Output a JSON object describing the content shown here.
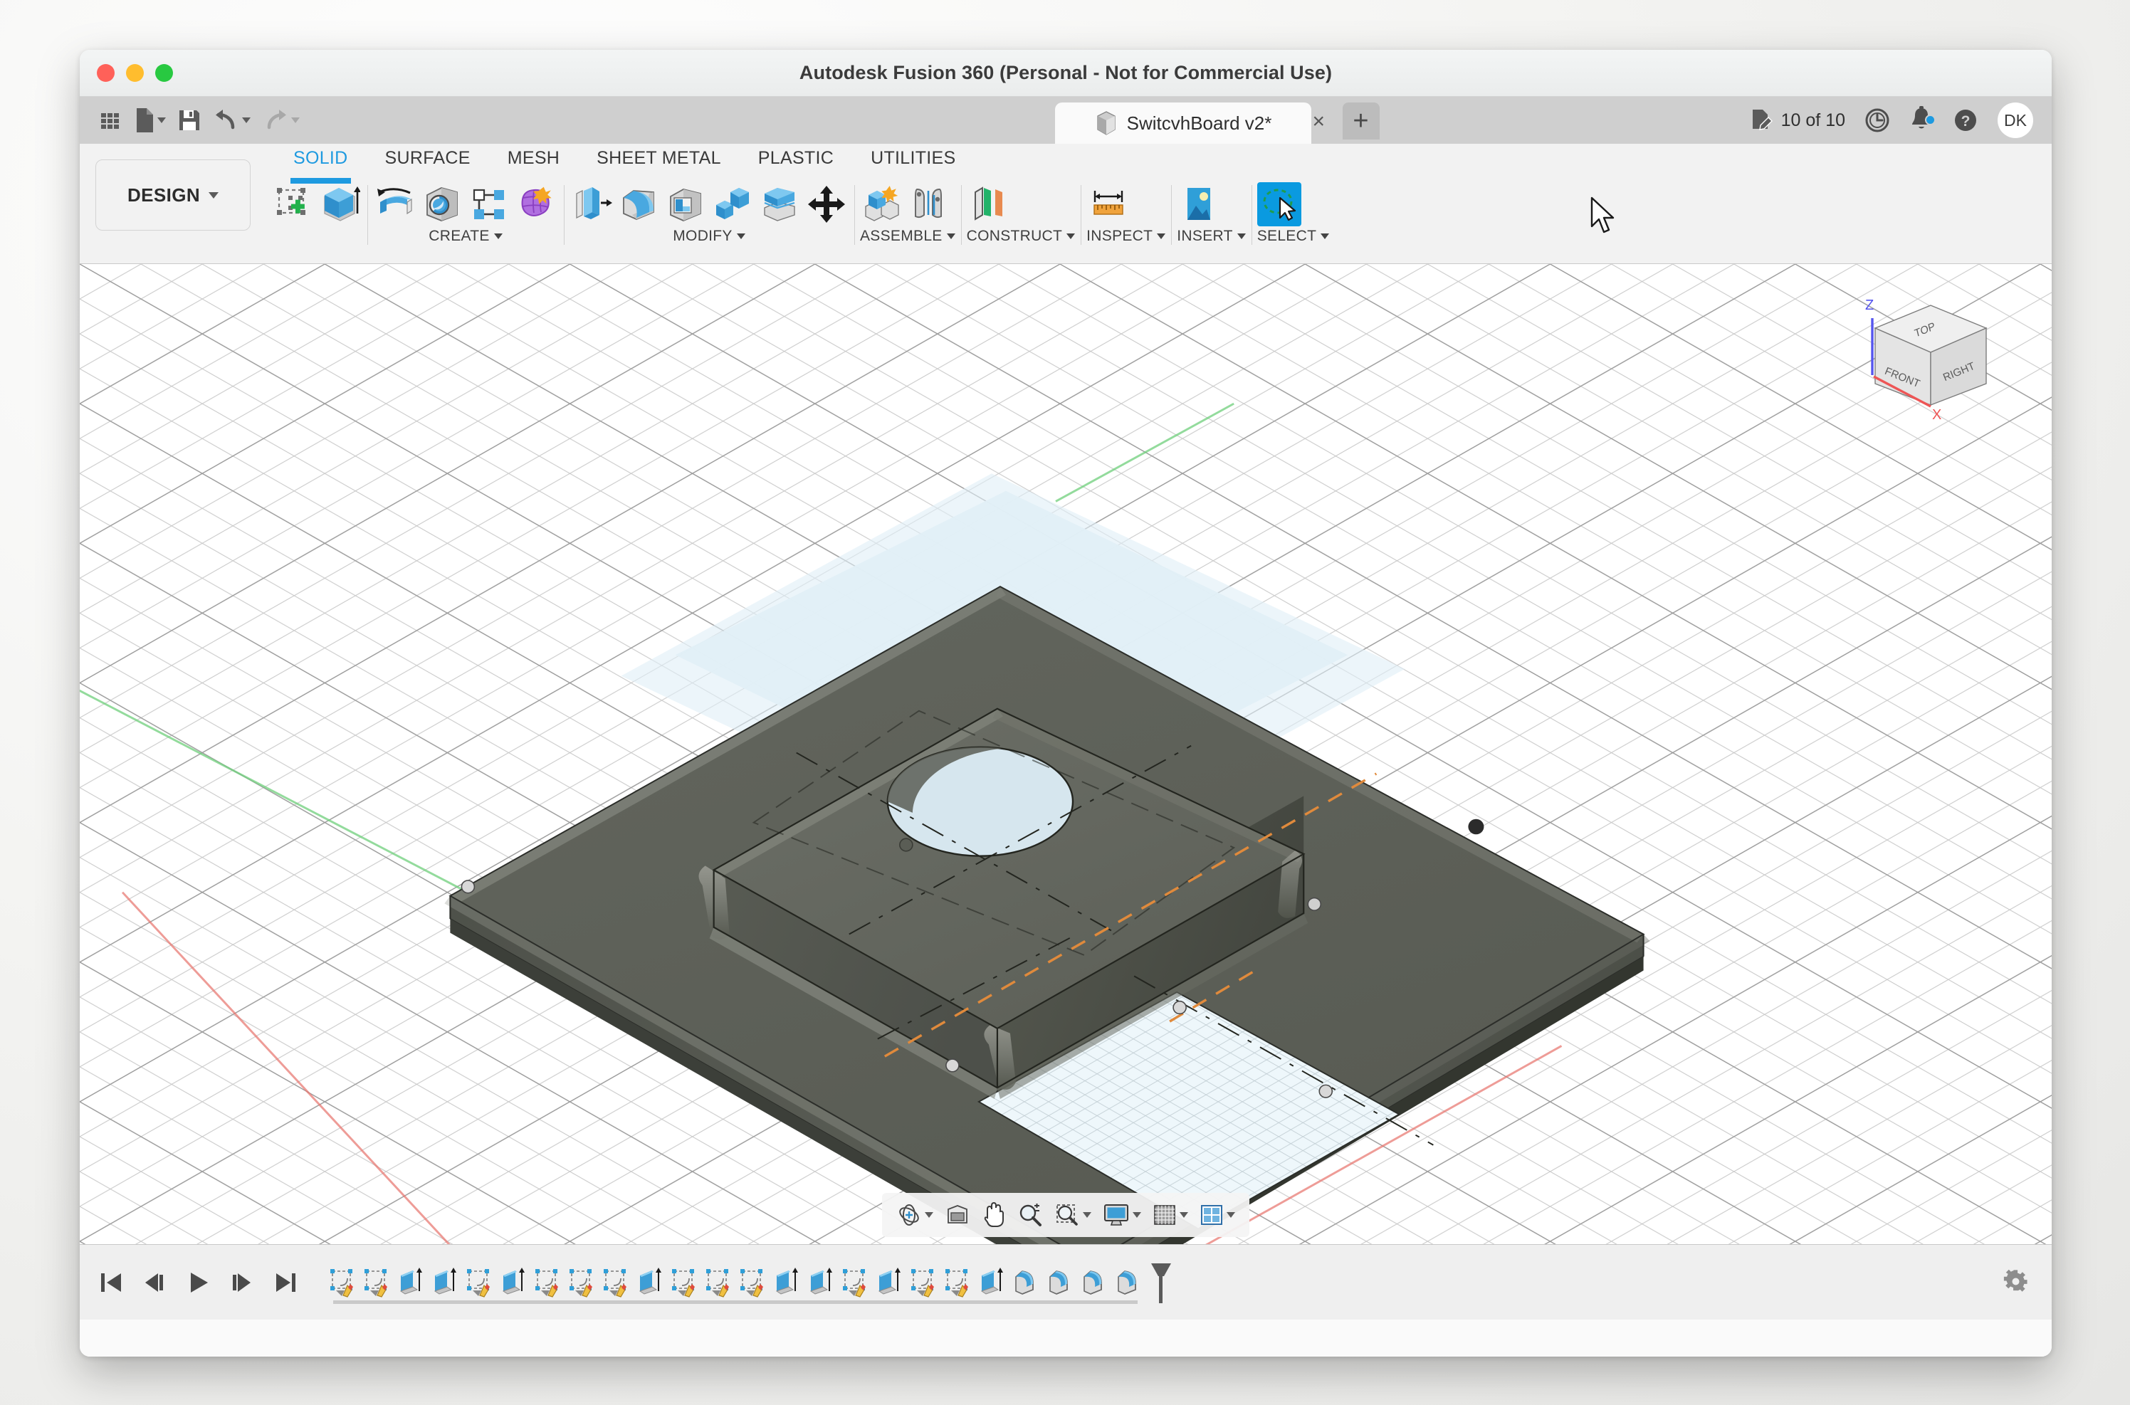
{
  "window": {
    "title": "Autodesk Fusion 360 (Personal - Not for Commercial Use)",
    "traffic": {
      "close": "close-button",
      "minimize": "minimize-button",
      "zoom": "zoom-button"
    }
  },
  "quick_access": {
    "items": [
      {
        "name": "show-data-panel",
        "icon": "grid-icon"
      },
      {
        "name": "file-menu",
        "icon": "file-icon",
        "has_caret": true
      },
      {
        "name": "save-button",
        "icon": "save-icon"
      },
      {
        "name": "undo-button",
        "icon": "undo-icon",
        "has_caret": true
      },
      {
        "name": "redo-button",
        "icon": "redo-icon",
        "has_caret": true
      }
    ]
  },
  "document_tab": {
    "label": "SwitcvhBoard v2*",
    "icon": "cube-icon",
    "close_label": "×",
    "new_tab_label": "+"
  },
  "header_right": {
    "jobs_status": "10 of 10",
    "jobs_icon": "job-status-icon",
    "history_icon": "clock-icon",
    "notifications_icon": "bell-icon",
    "notification_badge": true,
    "help_icon": "help-icon",
    "avatar_initials": "DK"
  },
  "ribbon": {
    "workspace_button": "DESIGN",
    "tabs": [
      {
        "label": "SOLID",
        "active": true
      },
      {
        "label": "SURFACE",
        "active": false
      },
      {
        "label": "MESH",
        "active": false
      },
      {
        "label": "SHEET METAL",
        "active": false
      },
      {
        "label": "PLASTIC",
        "active": false
      },
      {
        "label": "UTILITIES",
        "active": false
      }
    ],
    "panels": [
      {
        "label": "",
        "tools": [
          {
            "name": "create-sketch-button",
            "icon": "sketch-plus-icon"
          },
          {
            "name": "extrude-button",
            "icon": "extrude-icon"
          }
        ]
      },
      {
        "label": "CREATE",
        "tools": [
          {
            "name": "revolve-button",
            "icon": "revolve-icon"
          },
          {
            "name": "hole-button",
            "icon": "hole-icon"
          },
          {
            "name": "pattern-button",
            "icon": "pattern-icon"
          },
          {
            "name": "create-form-button",
            "icon": "form-icon"
          }
        ]
      },
      {
        "label": "MODIFY",
        "tools": [
          {
            "name": "press-pull-button",
            "icon": "press-pull-icon"
          },
          {
            "name": "fillet-button",
            "icon": "fillet-icon"
          },
          {
            "name": "shell-button",
            "icon": "shell-icon"
          },
          {
            "name": "combine-button",
            "icon": "combine-icon"
          },
          {
            "name": "split-face-button",
            "icon": "split-face-icon"
          },
          {
            "name": "move-copy-button",
            "icon": "move-copy-icon"
          }
        ]
      },
      {
        "label": "ASSEMBLE",
        "tools": [
          {
            "name": "new-component-button",
            "icon": "new-component-icon"
          },
          {
            "name": "joint-button",
            "icon": "joint-icon"
          }
        ]
      },
      {
        "label": "CONSTRUCT",
        "tools": [
          {
            "name": "offset-plane-button",
            "icon": "offset-plane-icon"
          }
        ]
      },
      {
        "label": "INSPECT",
        "tools": [
          {
            "name": "measure-button",
            "icon": "measure-icon"
          }
        ]
      },
      {
        "label": "INSERT",
        "tools": [
          {
            "name": "insert-image-button",
            "icon": "image-icon"
          }
        ]
      },
      {
        "label": "SELECT",
        "selected": true,
        "tools": [
          {
            "name": "select-tool-button",
            "icon": "select-lasso-icon"
          }
        ]
      }
    ]
  },
  "viewport": {
    "viewcube": {
      "faces": {
        "top": "TOP",
        "front": "FRONT",
        "right": "RIGHT"
      },
      "axes": {
        "z": "Z",
        "x": "X"
      },
      "axis_colors": {
        "z": "#5555ee",
        "x": "#ee5555"
      }
    },
    "origin_axes": {
      "x_color": "#e8736c",
      "y_color": "#6fcf7c"
    },
    "model": {
      "name": "switch-board-plate",
      "body_color": "#5f6159",
      "body_highlight": "#6f7168",
      "sketch_plane_color": "#e8f3f8",
      "construction_line_color": "#2b2b2b",
      "sketch_line_color": "#e08a3c"
    },
    "navbar": [
      {
        "name": "orbit-button",
        "icon": "orbit-icon",
        "has_caret": true
      },
      {
        "name": "look-at-button",
        "icon": "look-at-icon",
        "has_caret": false
      },
      {
        "name": "pan-button",
        "icon": "pan-hand-icon",
        "has_caret": false
      },
      {
        "name": "zoom-button",
        "icon": "zoom-magnifier-icon",
        "has_caret": false
      },
      {
        "name": "zoom-window-button",
        "icon": "zoom-window-icon",
        "has_caret": true
      },
      {
        "name": "display-settings-button",
        "icon": "monitor-icon",
        "has_caret": true
      },
      {
        "name": "grid-snap-button",
        "icon": "grid-icon",
        "has_caret": true
      },
      {
        "name": "viewports-button",
        "icon": "viewports-icon",
        "has_caret": true
      }
    ]
  },
  "timeline": {
    "playback": [
      {
        "name": "go-to-beginning-button",
        "icon": "skip-start-icon"
      },
      {
        "name": "step-back-button",
        "icon": "step-back-icon"
      },
      {
        "name": "play-button",
        "icon": "play-icon"
      },
      {
        "name": "step-forward-button",
        "icon": "step-forward-icon"
      },
      {
        "name": "go-to-end-button",
        "icon": "skip-end-icon"
      }
    ],
    "features": [
      {
        "type": "sketch",
        "icon": "sketch-feature-icon"
      },
      {
        "type": "sketch",
        "icon": "sketch-feature-icon"
      },
      {
        "type": "extrude",
        "icon": "extrude-feature-icon"
      },
      {
        "type": "extrude",
        "icon": "extrude-feature-icon"
      },
      {
        "type": "sketch",
        "icon": "sketch-feature-icon"
      },
      {
        "type": "extrude",
        "icon": "extrude-feature-icon"
      },
      {
        "type": "sketch",
        "icon": "sketch-feature-icon"
      },
      {
        "type": "sketch",
        "icon": "sketch-feature-icon"
      },
      {
        "type": "sketch",
        "icon": "sketch-feature-icon"
      },
      {
        "type": "extrude",
        "icon": "extrude-feature-icon"
      },
      {
        "type": "sketch",
        "icon": "sketch-feature-icon"
      },
      {
        "type": "sketch",
        "icon": "sketch-feature-icon"
      },
      {
        "type": "sketch",
        "icon": "sketch-feature-icon"
      },
      {
        "type": "extrude",
        "icon": "extrude-feature-icon"
      },
      {
        "type": "extrude",
        "icon": "extrude-feature-icon"
      },
      {
        "type": "sketch",
        "icon": "sketch-feature-icon"
      },
      {
        "type": "extrude",
        "icon": "extrude-feature-icon"
      },
      {
        "type": "sketch",
        "icon": "sketch-feature-icon"
      },
      {
        "type": "sketch",
        "icon": "sketch-feature-icon"
      },
      {
        "type": "extrude",
        "icon": "extrude-feature-icon"
      },
      {
        "type": "fillet",
        "icon": "fillet-feature-icon"
      },
      {
        "type": "fillet",
        "icon": "fillet-feature-icon"
      },
      {
        "type": "fillet",
        "icon": "fillet-feature-icon"
      },
      {
        "type": "fillet",
        "icon": "fillet-feature-icon"
      }
    ],
    "marker_position": "end",
    "settings_icon": "gear-icon"
  }
}
